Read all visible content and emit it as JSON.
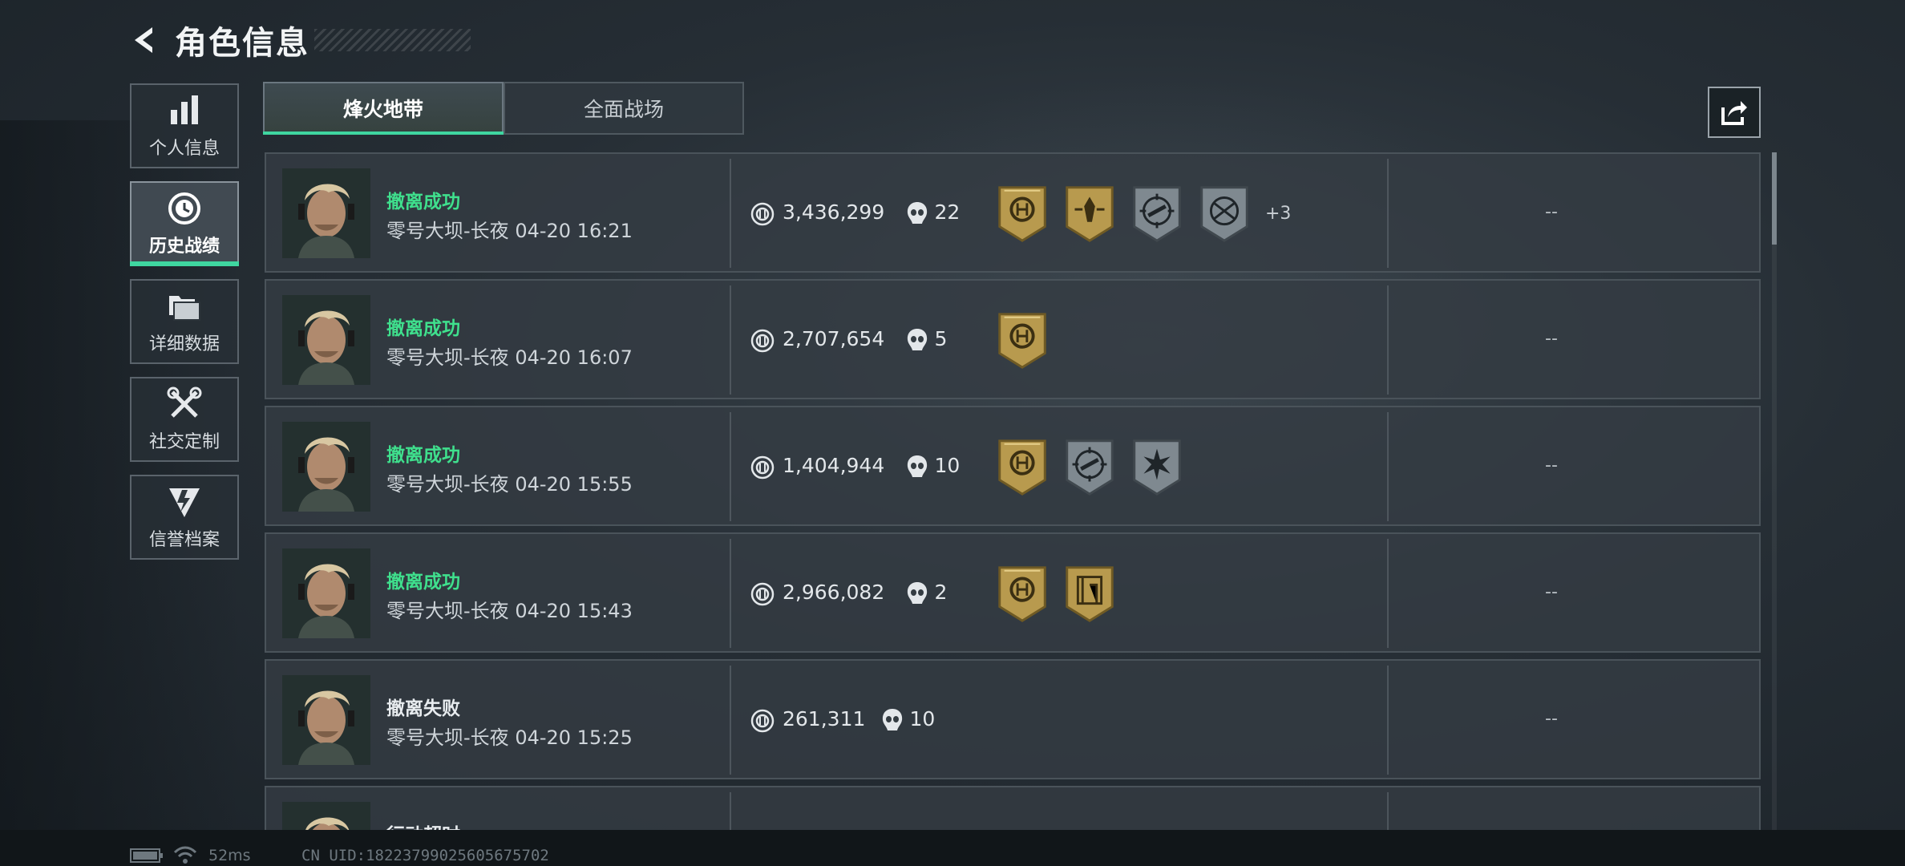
{
  "header": {
    "title": "角色信息"
  },
  "sidebar": {
    "items": [
      {
        "label": "个人信息",
        "icon": "bar-chart-icon",
        "active": false
      },
      {
        "label": "历史战绩",
        "icon": "history-clock-icon",
        "active": true
      },
      {
        "label": "详细数据",
        "icon": "folders-icon",
        "active": false
      },
      {
        "label": "社交定制",
        "icon": "tools-icon",
        "active": false
      },
      {
        "label": "信誉档案",
        "icon": "shield-bolt-icon",
        "active": false
      }
    ]
  },
  "tabs": [
    {
      "label": "烽火地带",
      "active": true
    },
    {
      "label": "全面战场",
      "active": false
    }
  ],
  "records": [
    {
      "status": "撤离成功",
      "map": "零号大坝-长夜",
      "time": "04-20 16:21",
      "money": "3,436,299",
      "kills": "22",
      "badges": [
        "gold-coin",
        "gold-character",
        "silver-crosshair-rifle",
        "silver-crosshair-arrows"
      ],
      "more": "+3",
      "extra": "--"
    },
    {
      "status": "撤离成功",
      "map": "零号大坝-长夜",
      "time": "04-20 16:07",
      "money": "2,707,654",
      "kills": "5",
      "badges": [
        "gold-coin"
      ],
      "more": "",
      "extra": "--"
    },
    {
      "status": "撤离成功",
      "map": "零号大坝-长夜",
      "time": "04-20 15:55",
      "money": "1,404,944",
      "kills": "10",
      "badges": [
        "gold-coin",
        "silver-crosshair-rifle",
        "silver-burst"
      ],
      "more": "",
      "extra": "--"
    },
    {
      "status": "撤离成功",
      "map": "零号大坝-长夜",
      "time": "04-20 15:43",
      "money": "2,966,082",
      "kills": "2",
      "badges": [
        "gold-coin",
        "gold-building"
      ],
      "more": "",
      "extra": "--"
    },
    {
      "status": "撤离失败",
      "map": "零号大坝-长夜",
      "time": "04-20 15:25",
      "money": "261,311",
      "kills": "10",
      "badges": [],
      "more": "",
      "extra": "--"
    },
    {
      "status": "行动超时",
      "map": "",
      "time": "",
      "money": "",
      "kills": "",
      "badges": [],
      "more": "",
      "extra": ""
    }
  ],
  "footer": {
    "ping": "52ms",
    "uid": "CN UID:18223799025605675702"
  },
  "colors": {
    "accent": "#3fd6a0",
    "success": "#3fe08d",
    "gold": "#b89a4e",
    "silver": "#8a949b"
  }
}
